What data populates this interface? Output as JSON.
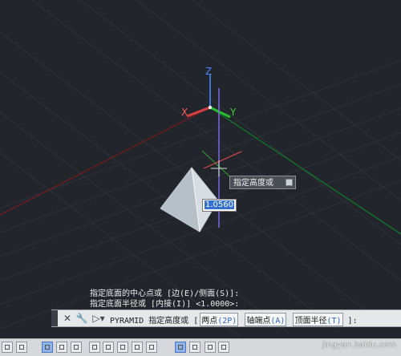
{
  "tooltip": {
    "label": "指定高度或"
  },
  "dynamic_input": {
    "value": "1.0560"
  },
  "history": [
    "指定底面的中心点或 [边(E)/侧面(S)]:",
    "指定底面半径或 [内接(I)] <1.0000>:"
  ],
  "command": {
    "name": "PYRAMID",
    "prompt": "指定高度或 [",
    "options": [
      {
        "label": "两点",
        "key": "(2P)"
      },
      {
        "label": "轴端点",
        "key": "(A)"
      },
      {
        "label": "顶面半径",
        "key": "(T)"
      }
    ],
    "tail": "]:"
  },
  "watermark": "jingyan.baidu.com",
  "axis_labels": {
    "x": "X",
    "y": "Y",
    "z": "Z"
  }
}
